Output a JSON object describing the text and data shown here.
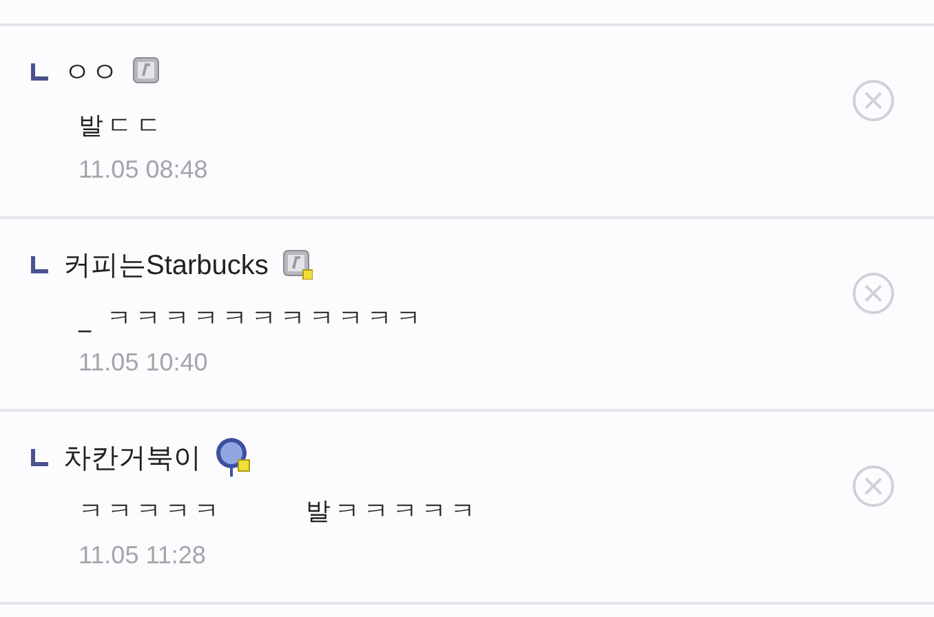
{
  "comments": [
    {
      "author": "ㅇㅇ",
      "badge": {
        "kind": "fixed"
      },
      "body": [
        "발ㄷㄷ"
      ],
      "time": "11.05 08:48"
    },
    {
      "author": "커피는Starbucks",
      "badge": {
        "kind": "fixed-verified"
      },
      "body": [
        "_ ㅋㅋㅋㅋㅋㅋㅋㅋㅋㅋㅋ"
      ],
      "time": "11.05 10:40"
    },
    {
      "author": "차칸거북이",
      "badge": {
        "kind": "round-verified"
      },
      "body": [
        "ㅋㅋㅋㅋㅋ",
        "발ㅋㅋㅋㅋㅋ"
      ],
      "time": "11.05 11:28"
    }
  ]
}
